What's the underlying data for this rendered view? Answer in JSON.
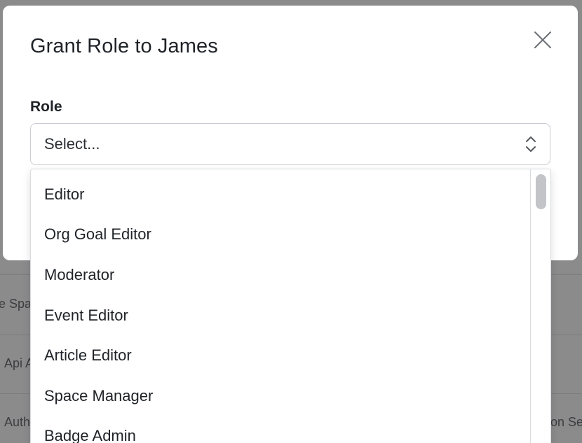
{
  "background": {
    "row_fragments": [
      {
        "text": "e Spa"
      },
      {
        "text": "Api A"
      },
      {
        "text": "Auth"
      },
      {
        "text": "on Se"
      }
    ]
  },
  "modal": {
    "title": "Grant Role to James",
    "close_icon": "close-icon",
    "role_field": {
      "label": "Role",
      "placeholder": "Select...",
      "icon": "chevron-up-down-icon"
    }
  },
  "dropdown": {
    "options": [
      "Editor",
      "Org Goal Editor",
      "Moderator",
      "Event Editor",
      "Article Editor",
      "Space Manager",
      "Badge Admin"
    ]
  },
  "colors": {
    "overlay": "#8b8b8c",
    "modal_bg": "#ffffff",
    "text": "#1f2328",
    "border": "#c9cdd2",
    "scroll_thumb": "#c2c4c7"
  }
}
